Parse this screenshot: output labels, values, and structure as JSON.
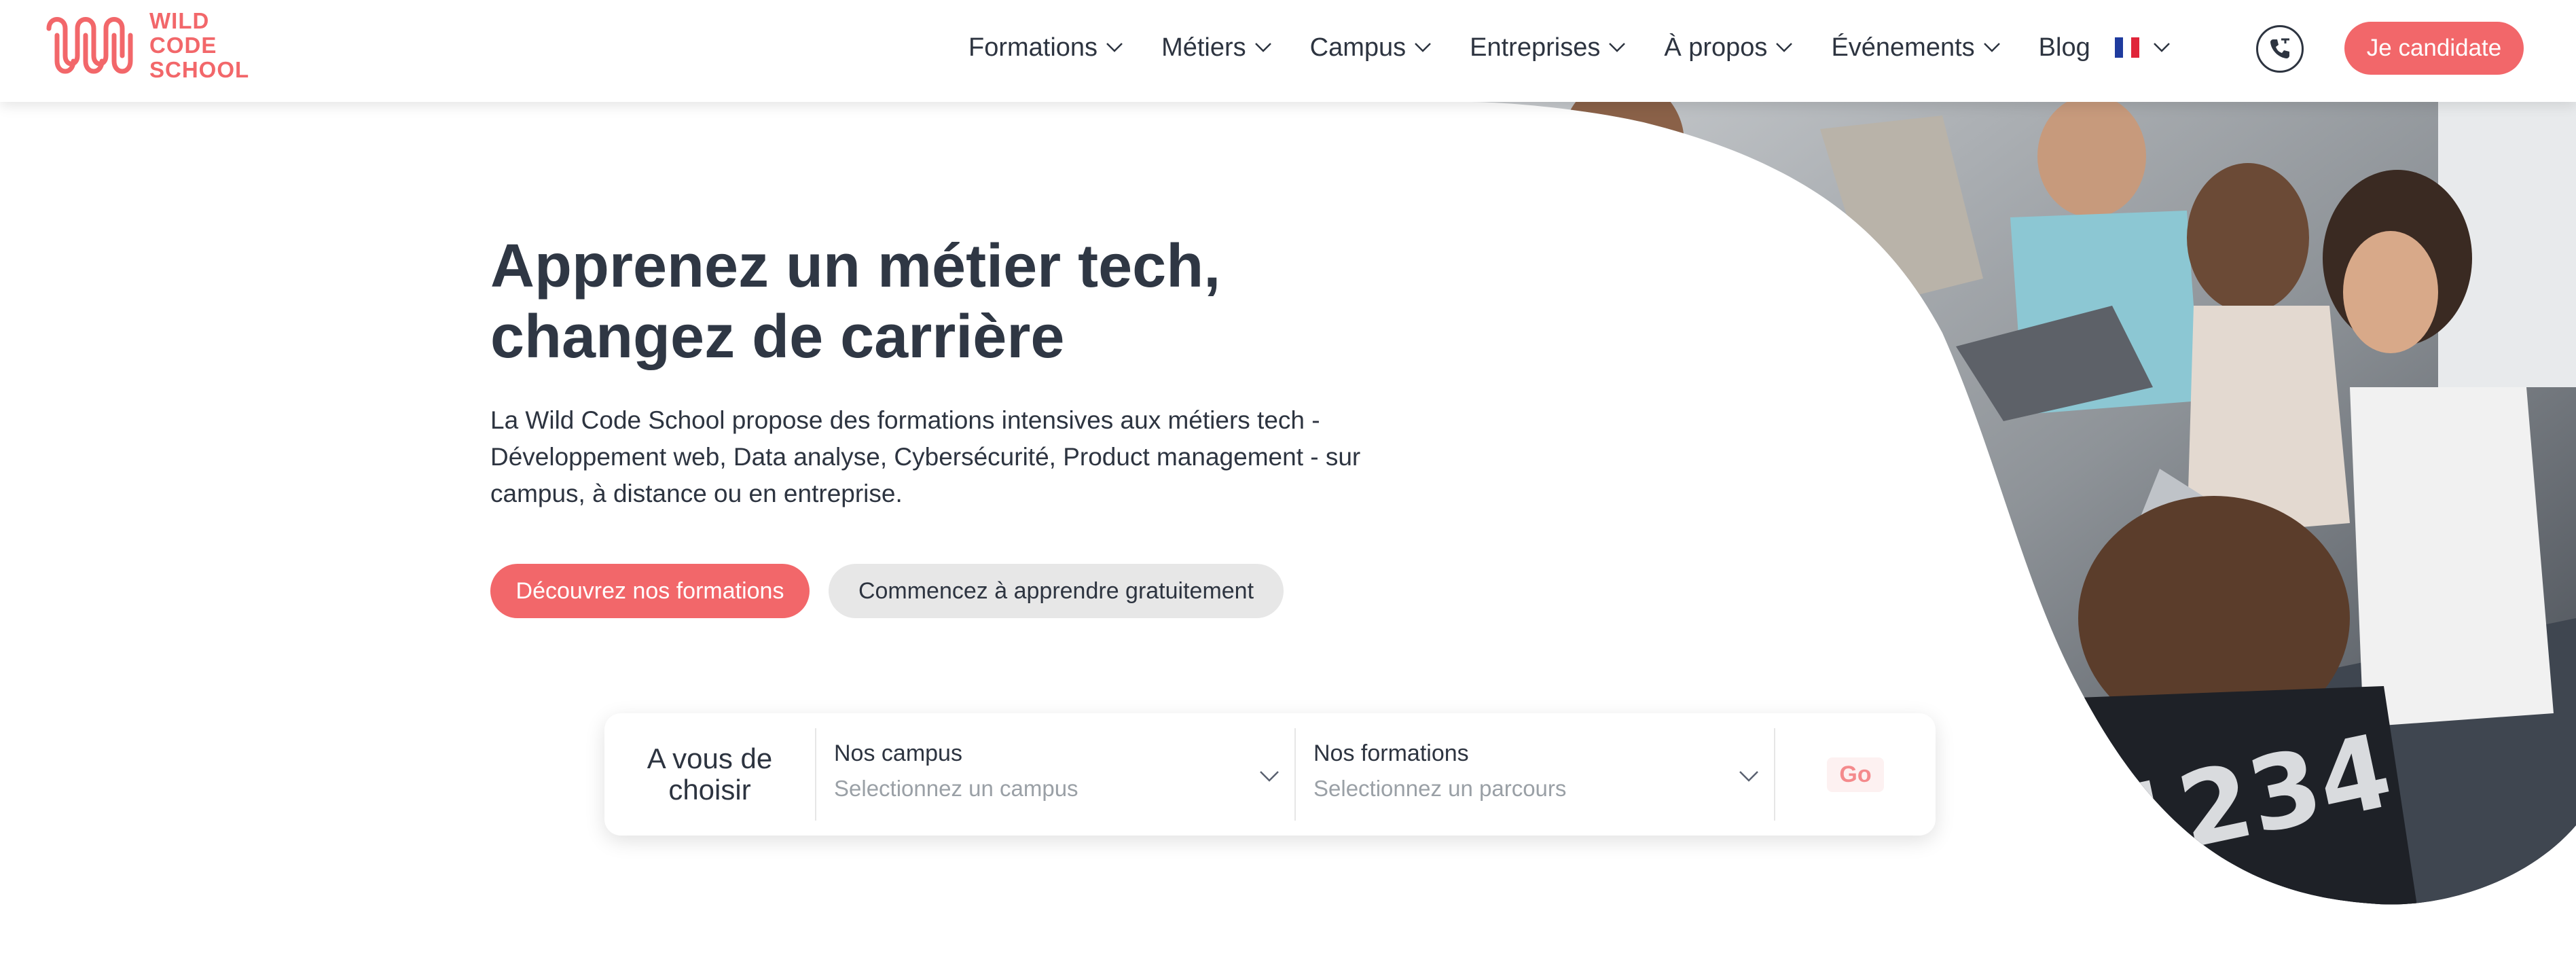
{
  "brand": {
    "logo_lines": [
      "WILD",
      "CODE",
      "SCHOOL"
    ],
    "accent_color": "#f2676a"
  },
  "nav": {
    "items": [
      {
        "label": "Formations",
        "has_dropdown": true
      },
      {
        "label": "Métiers",
        "has_dropdown": true
      },
      {
        "label": "Campus",
        "has_dropdown": true
      },
      {
        "label": "Entreprises",
        "has_dropdown": true
      },
      {
        "label": "À propos",
        "has_dropdown": true
      },
      {
        "label": "Événements",
        "has_dropdown": true
      }
    ],
    "blog_label": "Blog",
    "language_icon": "french-flag-icon",
    "phone_icon": "phone-icon",
    "apply_label": "Je candidate"
  },
  "hero": {
    "title_lines": [
      "Apprenez un métier tech,",
      "changez de carrière"
    ],
    "description_lines": [
      "La Wild Code School propose des formations intensives aux métiers tech -",
      "Développement web, Data analyse, Cybersécurité, Product management - sur",
      "campus, à distance ou en entreprise."
    ],
    "primary_cta": "Découvrez nos formations",
    "secondary_cta": "Commencez à apprendre gratuitement"
  },
  "search": {
    "intro_lines": [
      "A vous de",
      "choisir"
    ],
    "campus": {
      "label": "Nos campus",
      "placeholder": "Selectionnez un campus"
    },
    "formations": {
      "label": "Nos formations",
      "placeholder": "Selectionnez un parcours"
    },
    "go_label": "Go"
  }
}
